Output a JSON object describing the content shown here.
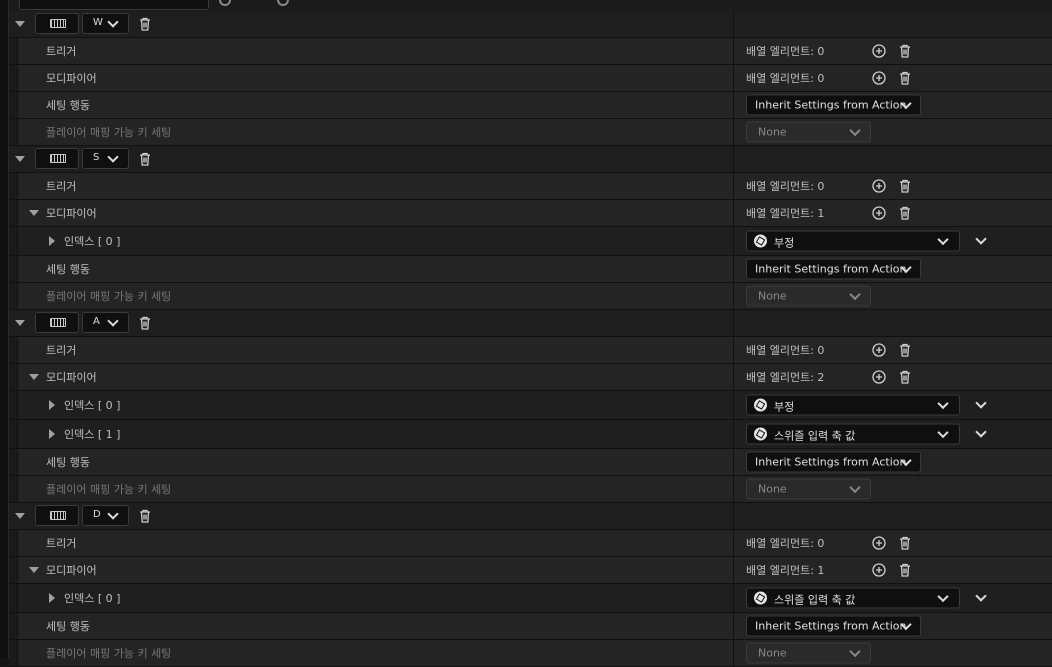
{
  "array_elements_label": "배열 엘리먼트: ",
  "mappings": [
    {
      "key": "W",
      "trigger_label": "트리거",
      "trigger_count": "0",
      "modifier_label": "모디파이어",
      "modifier_count": "0",
      "modifier_expanded": false,
      "modifiers": [],
      "setting_behavior_label": "세팅 행동",
      "setting_behavior_value": "Inherit Settings from Action",
      "player_mappable_label": "플레이어 매핑 가능 키 세팅",
      "player_mappable_value": "None"
    },
    {
      "key": "S",
      "trigger_label": "트리거",
      "trigger_count": "0",
      "modifier_label": "모디파이어",
      "modifier_count": "1",
      "modifier_expanded": true,
      "modifiers": [
        {
          "index_label": "인덱스 [ 0 ]",
          "value": "부정"
        }
      ],
      "setting_behavior_label": "세팅 행동",
      "setting_behavior_value": "Inherit Settings from Action",
      "player_mappable_label": "플레이어 매핑 가능 키 세팅",
      "player_mappable_value": "None"
    },
    {
      "key": "A",
      "trigger_label": "트리거",
      "trigger_count": "0",
      "modifier_label": "모디파이어",
      "modifier_count": "2",
      "modifier_expanded": true,
      "modifiers": [
        {
          "index_label": "인덱스 [ 0 ]",
          "value": "부정"
        },
        {
          "index_label": "인덱스 [ 1 ]",
          "value": "스위즐 입력 축 값"
        }
      ],
      "setting_behavior_label": "세팅 행동",
      "setting_behavior_value": "Inherit Settings from Action",
      "player_mappable_label": "플레이어 매핑 가능 키 세팅",
      "player_mappable_value": "None"
    },
    {
      "key": "D",
      "trigger_label": "트리거",
      "trigger_count": "0",
      "modifier_label": "모디파이어",
      "modifier_count": "1",
      "modifier_expanded": true,
      "modifiers": [
        {
          "index_label": "인덱스 [ 0 ]",
          "value": "스위즐 입력 축 값"
        }
      ],
      "setting_behavior_label": "세팅 행동",
      "setting_behavior_value": "Inherit Settings from Action",
      "player_mappable_label": "플레이어 매핑 가능 키 세팅",
      "player_mappable_value": "None"
    }
  ],
  "icons": {
    "keyboard": "keyboard-icon",
    "delete": "trash-icon",
    "add": "plus-circle-icon",
    "modifier": "modifier-icon"
  },
  "colors": {
    "background": "#151515",
    "row": "#242424",
    "header_row": "#1e1e1e",
    "text": "#c0c0c0",
    "dim_text": "#777777"
  }
}
